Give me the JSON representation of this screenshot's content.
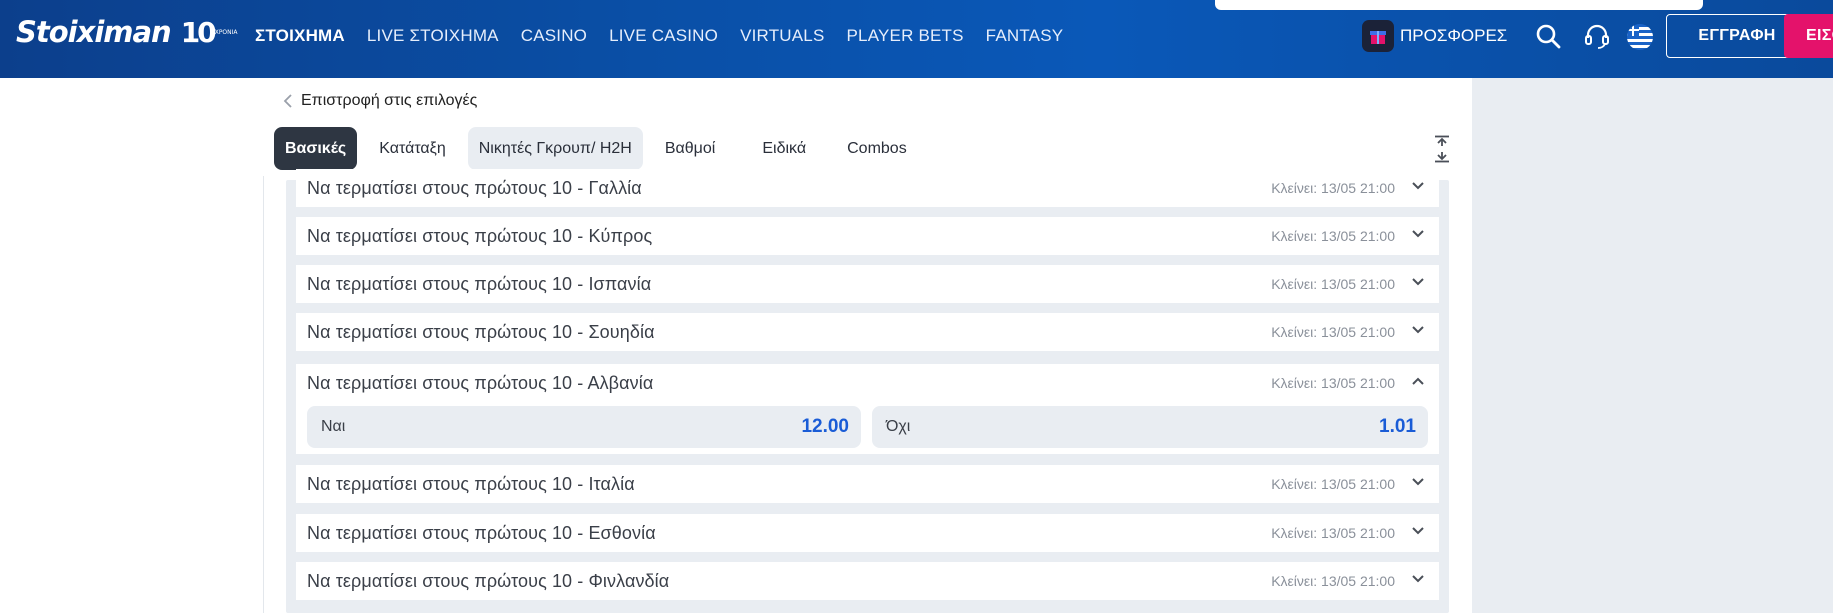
{
  "brand": {
    "name": "Stoiximan",
    "badge": "10",
    "badge_sub": "ΧΡΟΝΙΑ"
  },
  "nav": {
    "items": [
      {
        "label": "ΣΤΟΙΧΗΜΑ",
        "active": true
      },
      {
        "label": "LIVE ΣΤΟΙΧΗΜΑ"
      },
      {
        "label": "CASINO"
      },
      {
        "label": "LIVE CASINO"
      },
      {
        "label": "VIRTUALS"
      },
      {
        "label": "PLAYER BETS"
      },
      {
        "label": "FANTASY"
      }
    ],
    "promotions_label": "ΠΡΟΣΦΟΡΕΣ",
    "register_label": "ΕΓΓΡΑΦΗ",
    "login_label": "ΕΙΣΟ"
  },
  "back_label": "Επιστροφή στις επιλογές",
  "tabs": [
    "Βασικές",
    "Κατάταξη",
    "Νικητές Γκρουπ/ H2H",
    "Βαθμοί",
    "Ειδικά",
    "Combos"
  ],
  "markets": {
    "rows": [
      {
        "title": "Να τερματίσει στους πρώτους 10 - Γαλλία",
        "closes": "Κλείνει: 13/05 21:00"
      },
      {
        "title": "Να τερματίσει στους πρώτους 10 - Κύπρος",
        "closes": "Κλείνει: 13/05 21:00"
      },
      {
        "title": "Να τερματίσει στους πρώτους 10 - Ισπανία",
        "closes": "Κλείνει: 13/05 21:00"
      },
      {
        "title": "Να τερματίσει στους πρώτους 10 - Σουηδία",
        "closes": "Κλείνει: 13/05 21:00"
      },
      {
        "title": "Να τερματίσει στους πρώτους 10 - Αλβανία",
        "closes": "Κλείνει: 13/05 21:00"
      },
      {
        "title": "Να τερματίσει στους πρώτους 10 - Ιταλία",
        "closes": "Κλείνει: 13/05 21:00"
      },
      {
        "title": "Να τερματίσει στους πρώτους 10 - Εσθονία",
        "closes": "Κλείνει: 13/05 21:00"
      },
      {
        "title": "Να τερματίσει στους πρώτους 10 - Φινλανδία",
        "closes": "Κλείνει: 13/05 21:00"
      }
    ],
    "odds": {
      "yes_label": "Ναι",
      "yes_value": "12.00",
      "no_label": "Όχι",
      "no_value": "1.01"
    }
  },
  "colors": {
    "header_blue": "#0a4fa6",
    "accent_pink": "#e4126b",
    "odds_blue": "#1a5cd6",
    "active_tab": "#2e3642"
  }
}
